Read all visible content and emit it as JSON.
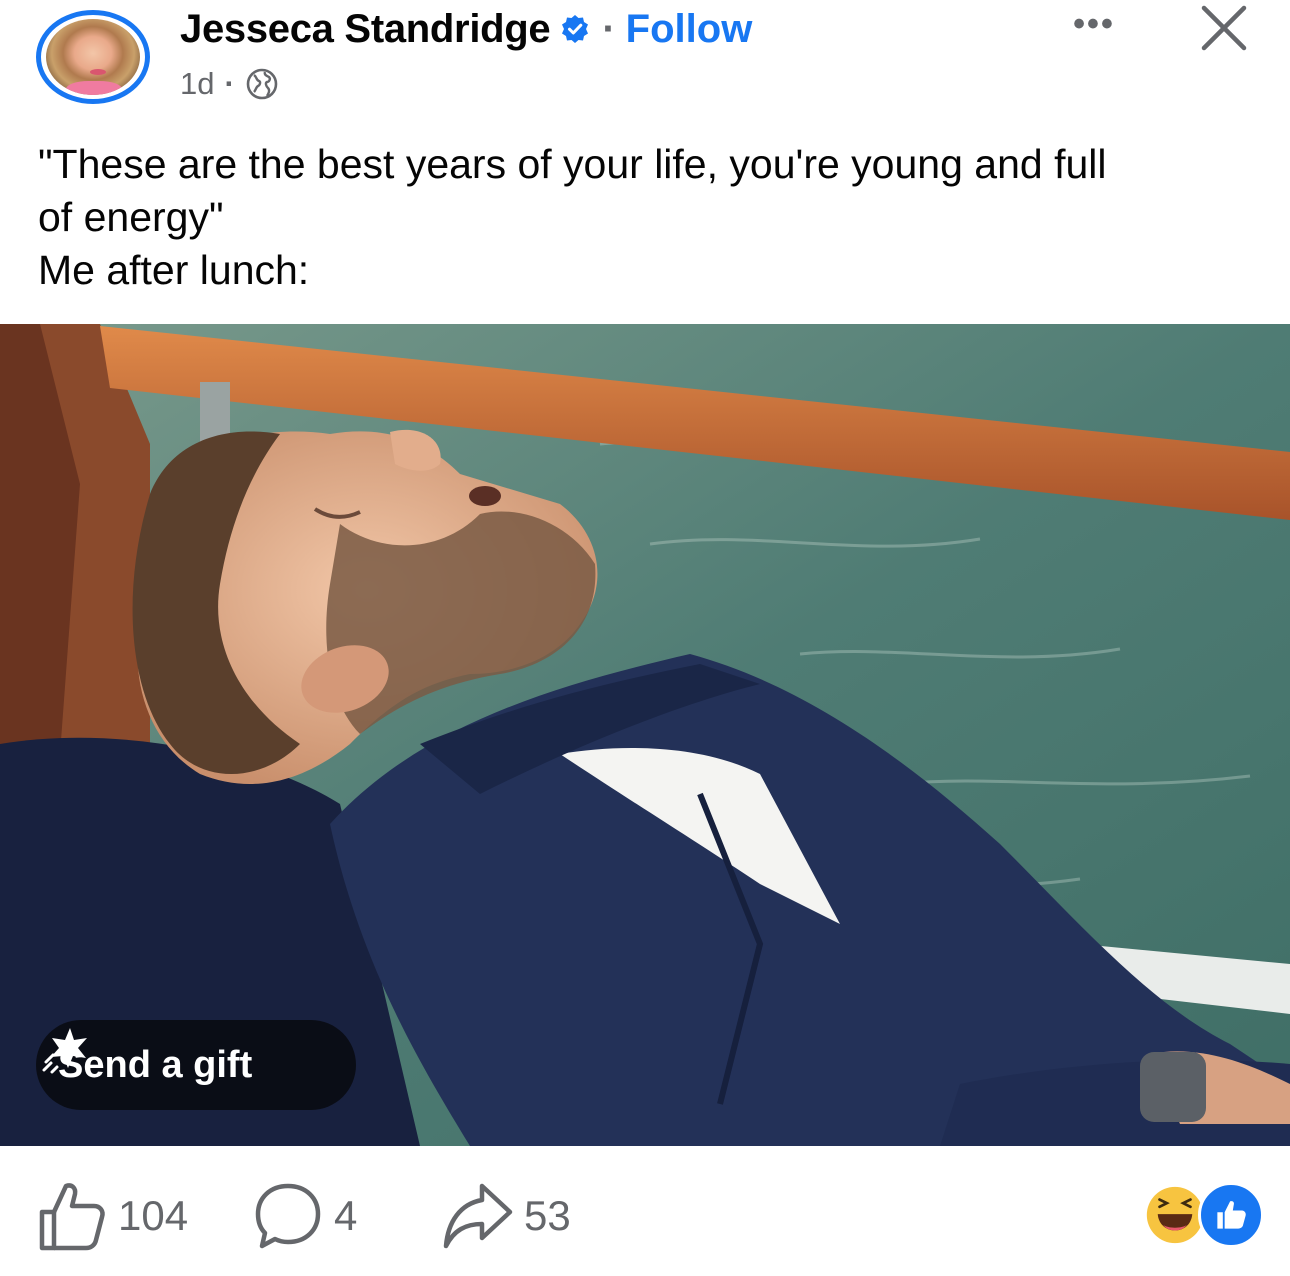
{
  "post": {
    "author": {
      "name": "Jesseca Standridge",
      "verified": true,
      "follow_label": "Follow",
      "separator": "·"
    },
    "meta": {
      "time": "1d",
      "separator": "·",
      "audience_icon": "globe-icon"
    },
    "menu": {
      "more_icon": "more-options-icon",
      "more_glyph": "•••",
      "close_icon": "close-icon"
    },
    "caption": {
      "line1": "\"These are the best years of your life, you're young and full",
      "line2": "of energy\"",
      "line3": "Me after lunch:"
    },
    "image": {
      "gift_button": {
        "label": "Send a gift",
        "icon": "gift-sparkle-icon"
      }
    },
    "stats": {
      "likes": "104",
      "comments": "4",
      "shares": "53",
      "reactions": [
        "haha-reaction-icon",
        "like-reaction-icon"
      ]
    }
  },
  "colors": {
    "accent": "#1877f2",
    "text": "#050505",
    "secondary_text": "#65676b",
    "background": "#ffffff"
  }
}
